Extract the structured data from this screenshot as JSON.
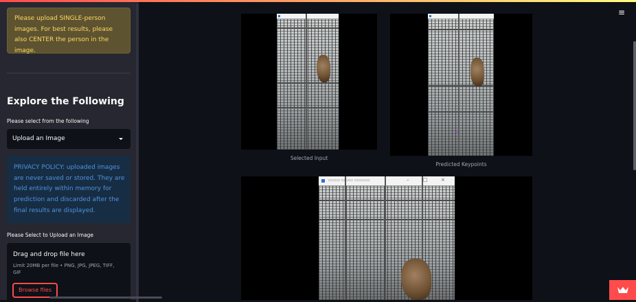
{
  "sidebar": {
    "warning_text": "Please upload SINGLE-person images. For best results, please also CENTER the person in the image.",
    "explore_heading": "Explore the Following",
    "select_label": "Please select from the following",
    "select_value": "Upload an Image",
    "privacy_text": "PRIVACY POLICY: uploaded images are never saved or stored. They are held entirely within memory for prediction and discarded after the final results are displayed.",
    "upload_label": "Please Select to Upload an Image",
    "dropzone": {
      "title": "Drag and drop file here",
      "limit": "Limit 20MB per file • PNG, JPG, JPEG, TIFF, GIF",
      "browse_label": "Browse files"
    }
  },
  "main": {
    "menu_icon": "hamburger-menu-icon",
    "images": [
      {
        "caption": "Selected Input"
      },
      {
        "caption": "Predicted Keypoints"
      },
      {
        "caption": ""
      }
    ]
  },
  "colors": {
    "accent": "#ff4b4b",
    "warning_bg": "#5d5330",
    "warning_text": "#ffd863",
    "info_bg": "#172d43",
    "info_text": "#4f93e0",
    "sidebar_bg": "#262730",
    "main_bg": "#0e1117"
  }
}
